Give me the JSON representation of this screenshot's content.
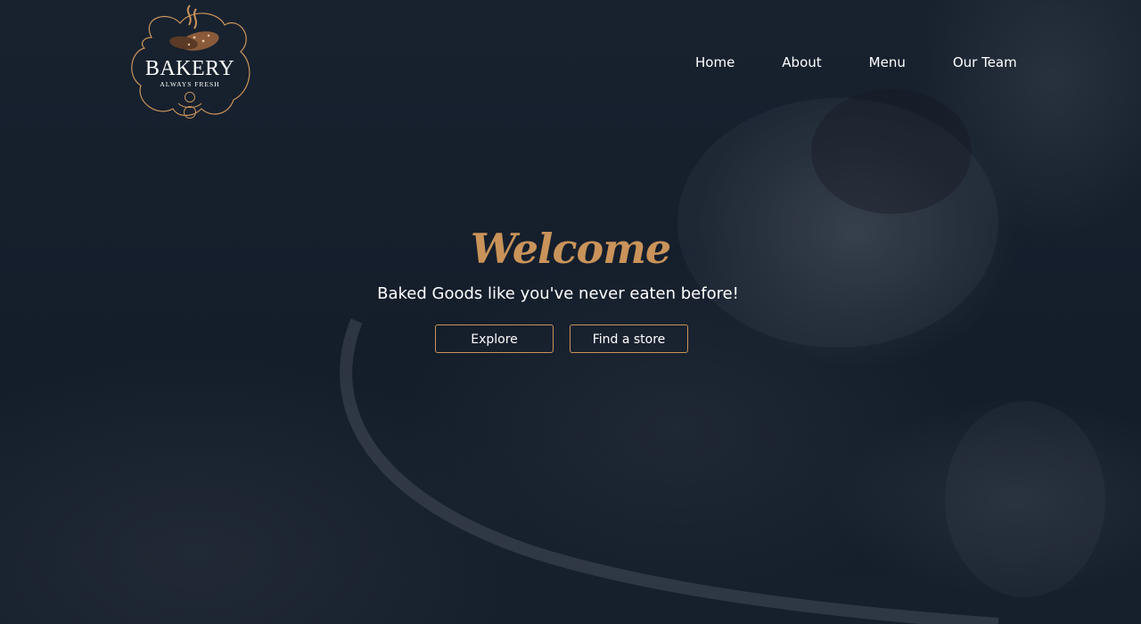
{
  "brand": {
    "name": "BAKERY",
    "tagline": "ALWAYS FRESH",
    "accent_color": "#c9935a",
    "icon": "bakery-logo-icon"
  },
  "nav": {
    "items": [
      {
        "label": "Home"
      },
      {
        "label": "About"
      },
      {
        "label": "Menu"
      },
      {
        "label": "Our Team"
      }
    ]
  },
  "hero": {
    "heading": "Welcome",
    "subheading": "Baked Goods like you've never eaten before!",
    "buttons": [
      {
        "label": "Explore"
      },
      {
        "label": "Find a store"
      }
    ]
  },
  "colors": {
    "background": "#141d2b",
    "accent": "#c9935a",
    "text": "#ffffff"
  }
}
